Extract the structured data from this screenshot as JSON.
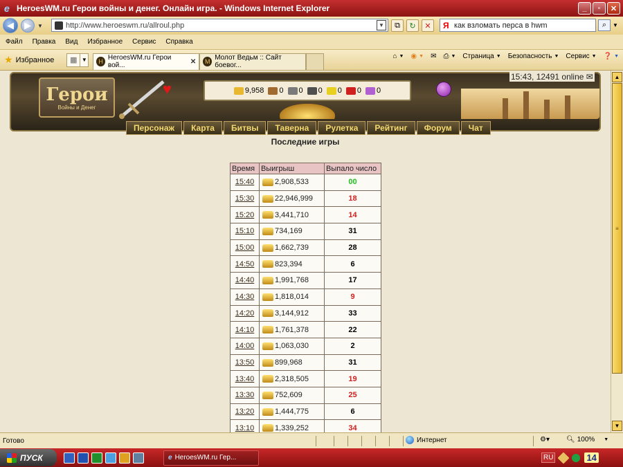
{
  "window": {
    "title": "HeroesWM.ru Герои войны и денег. Онлайн игра. - Windows Internet Explorer"
  },
  "address": {
    "url": "http://www.heroeswm.ru/allroul.php",
    "search_value": "как взломать перса в hwm",
    "search_engine_logo": "Я"
  },
  "menu": [
    "Файл",
    "Правка",
    "Вид",
    "Избранное",
    "Сервис",
    "Справка"
  ],
  "toolbar": {
    "favorites_label": "Избранное",
    "tabs": [
      {
        "label": "HeroesWM.ru Герои вой...",
        "active": true
      },
      {
        "label": "Молот Ведьм :: Сайт боевог...",
        "active": false
      }
    ],
    "commands": [
      "Страница",
      "Безопасность",
      "Сервис"
    ]
  },
  "game": {
    "logo_text": "Герои",
    "logo_sub": "Войны и Денег",
    "resources": [
      {
        "name": "gold",
        "value": "9,958",
        "color": "#e8b830"
      },
      {
        "name": "wood",
        "value": "0",
        "color": "#a06a30"
      },
      {
        "name": "ore",
        "value": "0",
        "color": "#7a7a7a"
      },
      {
        "name": "mercury",
        "value": "0",
        "color": "#505050"
      },
      {
        "name": "sulfur",
        "value": "0",
        "color": "#e8d020"
      },
      {
        "name": "crystals",
        "value": "0",
        "color": "#d02020"
      },
      {
        "name": "gems",
        "value": "0",
        "color": "#b060d0"
      }
    ],
    "online": "15:43, 12491 online",
    "nav": [
      "Персонаж",
      "Карта",
      "Битвы",
      "Таверна",
      "Рулетка",
      "Рейтинг",
      "Форум",
      "Чат"
    ],
    "heading": "Последние игры"
  },
  "table": {
    "headers": [
      "Время",
      "Выигрыш",
      "Выпало число"
    ],
    "rows": [
      {
        "time": "15:40",
        "win": "2,908,533",
        "num": "00",
        "color": "#20c020"
      },
      {
        "time": "15:30",
        "win": "22,946,999",
        "num": "18",
        "color": "#d02020"
      },
      {
        "time": "15:20",
        "win": "3,441,710",
        "num": "14",
        "color": "#d02020"
      },
      {
        "time": "15:10",
        "win": "734,169",
        "num": "31",
        "color": "#000000"
      },
      {
        "time": "15:00",
        "win": "1,662,739",
        "num": "28",
        "color": "#000000"
      },
      {
        "time": "14:50",
        "win": "823,394",
        "num": "6",
        "color": "#000000"
      },
      {
        "time": "14:40",
        "win": "1,991,768",
        "num": "17",
        "color": "#000000"
      },
      {
        "time": "14:30",
        "win": "1,818,014",
        "num": "9",
        "color": "#d02020"
      },
      {
        "time": "14:20",
        "win": "3,144,912",
        "num": "33",
        "color": "#000000"
      },
      {
        "time": "14:10",
        "win": "1,761,378",
        "num": "22",
        "color": "#000000"
      },
      {
        "time": "14:00",
        "win": "1,063,030",
        "num": "2",
        "color": "#000000"
      },
      {
        "time": "13:50",
        "win": "899,968",
        "num": "31",
        "color": "#000000"
      },
      {
        "time": "13:40",
        "win": "2,318,505",
        "num": "19",
        "color": "#d02020"
      },
      {
        "time": "13:30",
        "win": "752,609",
        "num": "25",
        "color": "#d02020"
      },
      {
        "time": "13:20",
        "win": "1,444,775",
        "num": "6",
        "color": "#000000"
      },
      {
        "time": "13:10",
        "win": "1,339,252",
        "num": "34",
        "color": "#d02020"
      }
    ]
  },
  "status": {
    "text": "Готово",
    "zone": "Интернет",
    "zoom": "100%"
  },
  "taskbar": {
    "start_label": "ПУСК",
    "task_label": "HeroesWM.ru Гер...",
    "lang": "RU",
    "clock": "14"
  }
}
